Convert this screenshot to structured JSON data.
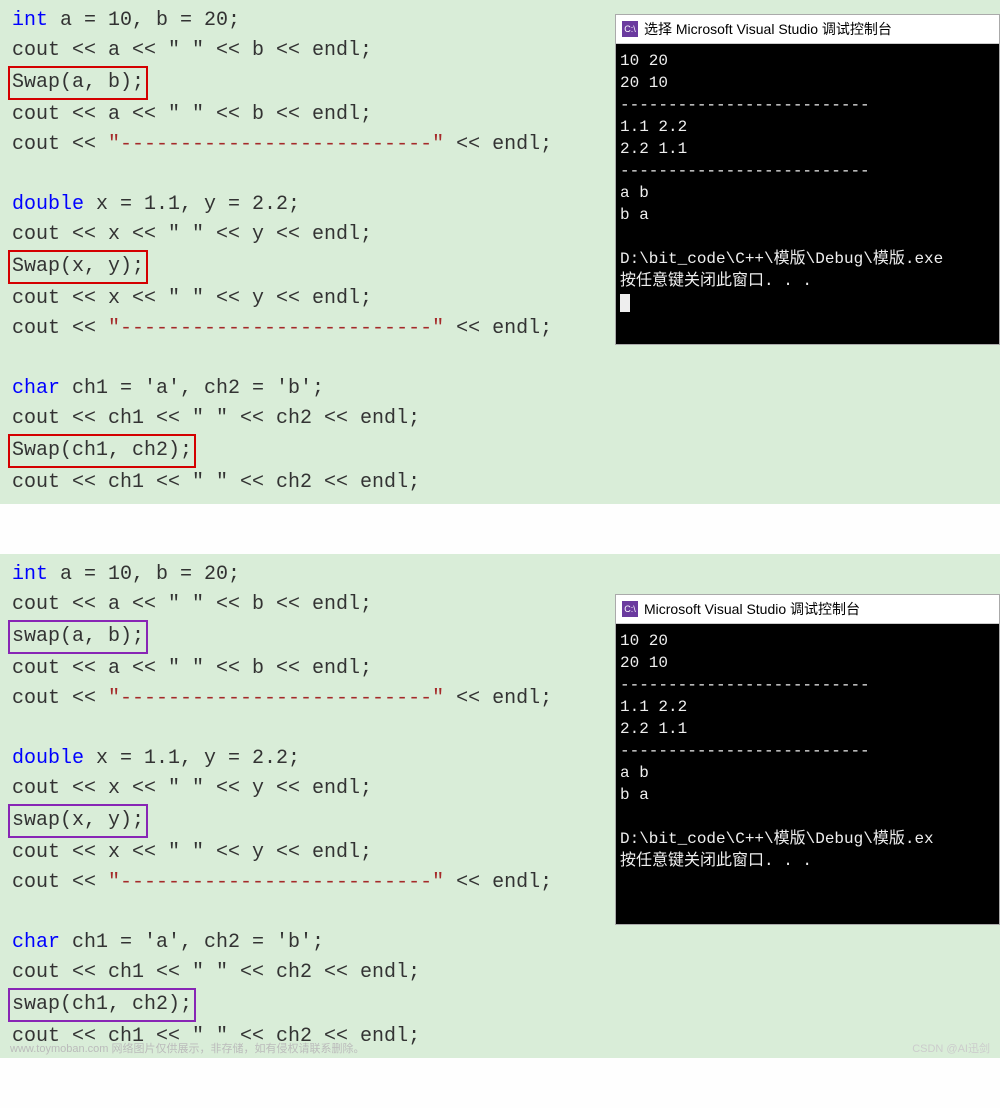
{
  "panel1": {
    "code": {
      "l1_a": "int",
      "l1_b": " a = 10, b = 20;",
      "l2": "cout << a << \" \" << b << endl;",
      "l3": "Swap(a, b);",
      "l4": "cout << a << \" \" << b << endl;",
      "l5_a": "cout << ",
      "l5_b": "\"--------------------------\"",
      "l5_c": " << endl;",
      "l6": "",
      "l7_a": "double",
      "l7_b": " x = 1.1, y = 2.2;",
      "l8": "cout << x << \" \" << y << endl;",
      "l9": "Swap(x, y);",
      "l10": "cout << x << \" \" << y << endl;",
      "l11_a": "cout << ",
      "l11_b": "\"--------------------------\"",
      "l11_c": " << endl;",
      "l12": "",
      "l13_a": "char",
      "l13_b": " ch1 = 'a', ch2 = 'b';",
      "l14": "cout << ch1 << \" \" << ch2 << endl;",
      "l15": "Swap(ch1, ch2);",
      "l16": "cout << ch1 << \" \" << ch2 << endl;"
    },
    "console": {
      "icon": "C:\\",
      "title": "选择 Microsoft Visual Studio 调试控制台",
      "output": "10 20\n20 10\n--------------------------\n1.1 2.2\n2.2 1.1\n--------------------------\na b\nb a\n\nD:\\bit_code\\C++\\模版\\Debug\\模版.exe\n按任意键关闭此窗口. . ."
    }
  },
  "panel2": {
    "code": {
      "l1_a": "int",
      "l1_b": " a = 10, b = 20;",
      "l2": "cout << a << \" \" << b << endl;",
      "l3": "swap(a, b);",
      "l4": "cout << a << \" \" << b << endl;",
      "l5_a": "cout << ",
      "l5_b": "\"--------------------------\"",
      "l5_c": " << endl;",
      "l6": "",
      "l7_a": "double",
      "l7_b": " x = 1.1, y = 2.2;",
      "l8": "cout << x << \" \" << y << endl;",
      "l9": "swap(x, y);",
      "l10": "cout << x << \" \" << y << endl;",
      "l11_a": "cout << ",
      "l11_b": "\"--------------------------\"",
      "l11_c": " << endl;",
      "l12": "",
      "l13_a": "char",
      "l13_b": " ch1 = 'a', ch2 = 'b';",
      "l14": "cout << ch1 << \" \" << ch2 << endl;",
      "l15": "swap(ch1, ch2);",
      "l16": "cout << ch1 << \" \" << ch2 << endl;"
    },
    "console": {
      "icon": "C:\\",
      "title": "Microsoft Visual Studio 调试控制台",
      "output": "10 20\n20 10\n--------------------------\n1.1 2.2\n2.2 1.1\n--------------------------\na b\nb a\n\nD:\\bit_code\\C++\\模版\\Debug\\模版.ex\n按任意键关闭此窗口. . ."
    }
  },
  "watermark": "www.toymoban.com 网络图片仅供展示，非存储，如有侵权请联系删除。",
  "csdn": "CSDN @AI迅剑"
}
